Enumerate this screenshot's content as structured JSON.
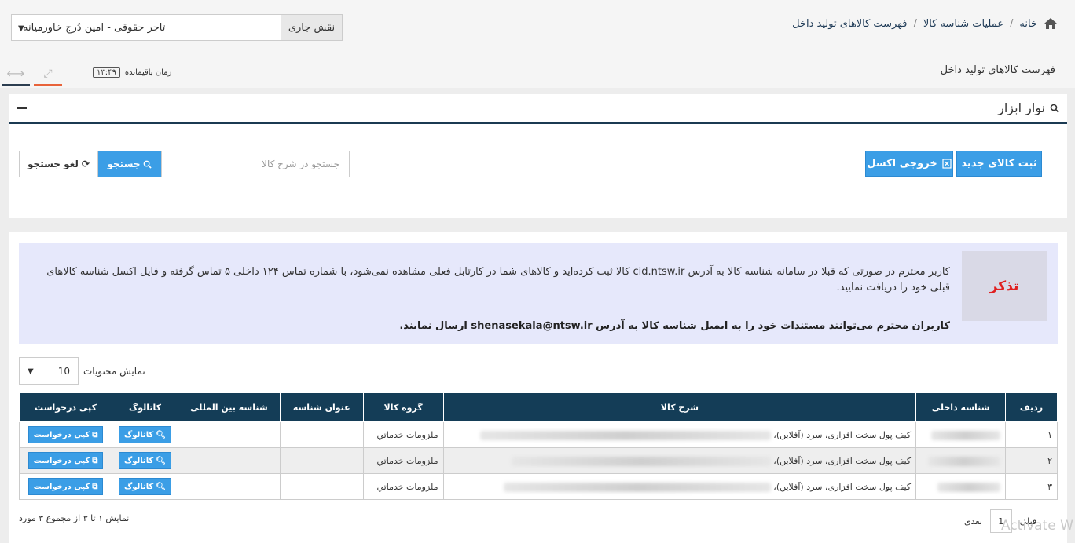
{
  "breadcrumb": {
    "home": "خانه",
    "ops": "عملیات شناسه کالا",
    "current": "فهرست کالاهای تولید داخل"
  },
  "role": {
    "label": "نقش جاری",
    "value": "تاجر حقوقی - امین دُرج خاورمیانه"
  },
  "subbar": {
    "title": "فهرست کالاهای تولید داخل",
    "timer_label": "زمان باقیمانده",
    "timer_value": "۱۳:۴۹"
  },
  "toolbar": {
    "title": "نوار ابزار",
    "new_label": "ثبت کالای جدید",
    "excel_label": "خروجی اکسل",
    "search_label": "جستجو",
    "cancel_label": "لغو جستجو",
    "search_placeholder": "جستجو در شرح کالا"
  },
  "notice": {
    "tag": "تذکر",
    "line1": "کاربر محترم در صورتی که قبلا در سامانه شناسه کالا به آدرس cid.ntsw.ir کالا ثبت کرده‌اید و کالاهای شما در کارتابل فعلی مشاهده نمی‌شود، با شماره تماس ۱۲۴ داخلی ۵ تماس گرفته و فایل اکسل شناسه کالاهای قبلی خود را دریافت نمایید.",
    "line2": "کاربران محترم می‌توانند مستندات خود را به ایمیل شناسه کالا به آدرس shenasekala@ntsw.ir ارسال نمایند."
  },
  "pagesize": {
    "label": "نمایش محتویات",
    "value": "10"
  },
  "table": {
    "headers": {
      "row": "ردیف",
      "internal": "شناسه داخلی",
      "desc": "شرح کالا",
      "group": "گروه کالا",
      "title": "عنوان شناسه",
      "intl": "شناسه بین المللی",
      "catalog": "کاتالوگ",
      "copy": "کپی درخواست"
    },
    "rows": [
      {
        "row": "۱",
        "desc": "کیف پول سخت افزاری، سرد (آفلاین)،",
        "group": "ملزومات خدماتي"
      },
      {
        "row": "۲",
        "desc": "کیف پول سخت افزاری، سرد (آفلاین)،",
        "group": "ملزومات خدماتي"
      },
      {
        "row": "۳",
        "desc": "کیف پول سخت افزاری، سرد (آفلاین)،",
        "group": "ملزومات خدماتي"
      }
    ],
    "catalog_btn": "کاتالوگ",
    "copy_btn": "کپی درخواست"
  },
  "footer": {
    "info": "نمایش ۱ تا ۳ از مجموع ۳ مورد",
    "prev": "قبلی",
    "page": "1",
    "next": "بعدی"
  },
  "watermark": "Activate W"
}
